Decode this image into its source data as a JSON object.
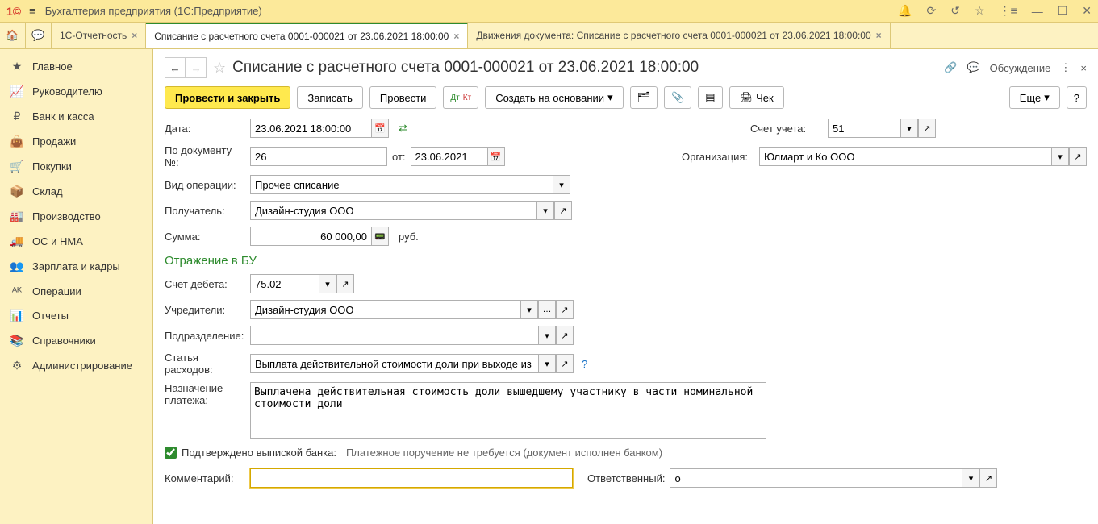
{
  "app": {
    "title": "Бухгалтерия предприятия  (1С:Предприятие)",
    "logo": "1@"
  },
  "tabs": [
    {
      "label": "1С-Отчетность",
      "active": false
    },
    {
      "label": "Списание с расчетного счета 0001-000021 от 23.06.2021 18:00:00",
      "active": true
    },
    {
      "label": "Движения документа: Списание с расчетного счета 0001-000021 от 23.06.2021 18:00:00",
      "active": false
    }
  ],
  "sidebar": {
    "items": [
      {
        "icon": "★",
        "label": "Главное"
      },
      {
        "icon": "📈",
        "label": "Руководителю"
      },
      {
        "icon": "₽",
        "label": "Банк и касса"
      },
      {
        "icon": "👜",
        "label": "Продажи"
      },
      {
        "icon": "🛒",
        "label": "Покупки"
      },
      {
        "icon": "📦",
        "label": "Склад"
      },
      {
        "icon": "🏭",
        "label": "Производство"
      },
      {
        "icon": "🚚",
        "label": "ОС и НМА"
      },
      {
        "icon": "👥",
        "label": "Зарплата и кадры"
      },
      {
        "icon": "ᴬᴷ",
        "label": "Операции"
      },
      {
        "icon": "📊",
        "label": "Отчеты"
      },
      {
        "icon": "📚",
        "label": "Справочники"
      },
      {
        "icon": "⚙",
        "label": "Администрирование"
      }
    ]
  },
  "doc": {
    "title": "Списание с расчетного счета 0001-000021 от 23.06.2021 18:00:00",
    "discuss_label": "Обсуждение"
  },
  "toolbar": {
    "post_close": "Провести и закрыть",
    "save": "Записать",
    "post": "Провести",
    "create_based": "Создать на основании",
    "check": "Чек",
    "more": "Еще",
    "help": "?"
  },
  "form": {
    "date_label": "Дата:",
    "date_value": "23.06.2021 18:00:00",
    "docnum_label": "По документу №:",
    "docnum_value": "26",
    "docnum_from": "от:",
    "docnum_date": "23.06.2021",
    "optype_label": "Вид операции:",
    "optype_value": "Прочее списание",
    "recipient_label": "Получатель:",
    "recipient_value": "Дизайн-студия ООО",
    "amount_label": "Сумма:",
    "amount_value": "60 000,00",
    "amount_currency": "руб.",
    "account_label": "Счет учета:",
    "account_value": "51",
    "org_label": "Организация:",
    "org_value": "Юлмарт и Ко ООО",
    "bu_section": "Отражение в БУ",
    "debit_label": "Счет дебета:",
    "debit_value": "75.02",
    "founders_label": "Учредители:",
    "founders_value": "Дизайн-студия ООО",
    "division_label": "Подразделение:",
    "expense_label": "Статья расходов:",
    "expense_value": "Выплата действительной стоимости доли при выходе из ОС",
    "purpose_label": "Назначение платежа:",
    "purpose_value": "Выплачена действительная стоимость доли вышедшему участнику в части номинальной стоимости доли",
    "confirmed_label": "Подтверждено выпиской банка:",
    "confirmed_note": "Платежное поручение не требуется (документ исполнен банком)",
    "comment_label": "Комментарий:",
    "comment_value": "",
    "responsible_label": "Ответственный:",
    "responsible_value": "о"
  }
}
